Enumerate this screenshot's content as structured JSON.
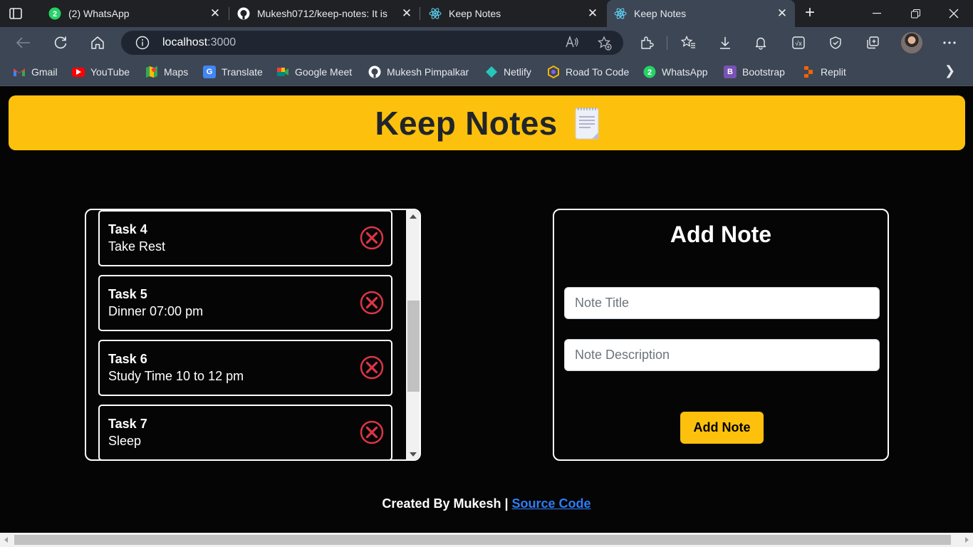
{
  "browser": {
    "tabs": [
      {
        "title": "(2) WhatsApp",
        "icon": "whatsapp-icon",
        "badge": "2"
      },
      {
        "title": "Mukesh0712/keep-notes: It is",
        "icon": "github-icon"
      },
      {
        "title": "Keep Notes",
        "icon": "react-icon"
      },
      {
        "title": "Keep Notes",
        "icon": "react-icon",
        "active": true
      }
    ],
    "url_host": "localhost",
    "url_port": ":3000",
    "read_aloud": "Áˢ",
    "bookmarks": [
      {
        "label": "Gmail",
        "icon": "gmail-icon",
        "color": "#ea4335"
      },
      {
        "label": "YouTube",
        "icon": "youtube-icon",
        "color": "#ff0000"
      },
      {
        "label": "Maps",
        "icon": "maps-icon",
        "color": "#34a853"
      },
      {
        "label": "Translate",
        "icon": "translate-icon",
        "color": "#4285f4"
      },
      {
        "label": "Google Meet",
        "icon": "meet-icon",
        "color": "#00897b"
      },
      {
        "label": "Mukesh Pimpalkar",
        "icon": "github-icon",
        "color": "#ffffff"
      },
      {
        "label": "Netlify",
        "icon": "netlify-icon",
        "color": "#25c7b7"
      },
      {
        "label": "Road To Code",
        "icon": "roadtocode-icon",
        "color": "#f4b400"
      },
      {
        "label": "WhatsApp",
        "icon": "whatsapp-icon",
        "color": "#25d366"
      },
      {
        "label": "Bootstrap",
        "icon": "bootstrap-icon",
        "color": "#7952b3"
      },
      {
        "label": "Replit",
        "icon": "replit-icon",
        "color": "#f26207"
      }
    ]
  },
  "app": {
    "title": "Keep Notes",
    "header_color": "#fdc10d",
    "notes": [
      {
        "title": "Task 4",
        "description": "Take Rest"
      },
      {
        "title": "Task 5",
        "description": "Dinner 07:00 pm"
      },
      {
        "title": "Task 6",
        "description": "Study Time 10 to 12 pm"
      },
      {
        "title": "Task 7",
        "description": "Sleep"
      }
    ],
    "form": {
      "heading": "Add Note",
      "title_placeholder": "Note Title",
      "description_placeholder": "Note Description",
      "submit_label": "Add Note"
    },
    "footer": {
      "text": "Created By Mukesh |",
      "link_label": "Source Code"
    },
    "delete_icon_color": "#dc3545"
  }
}
